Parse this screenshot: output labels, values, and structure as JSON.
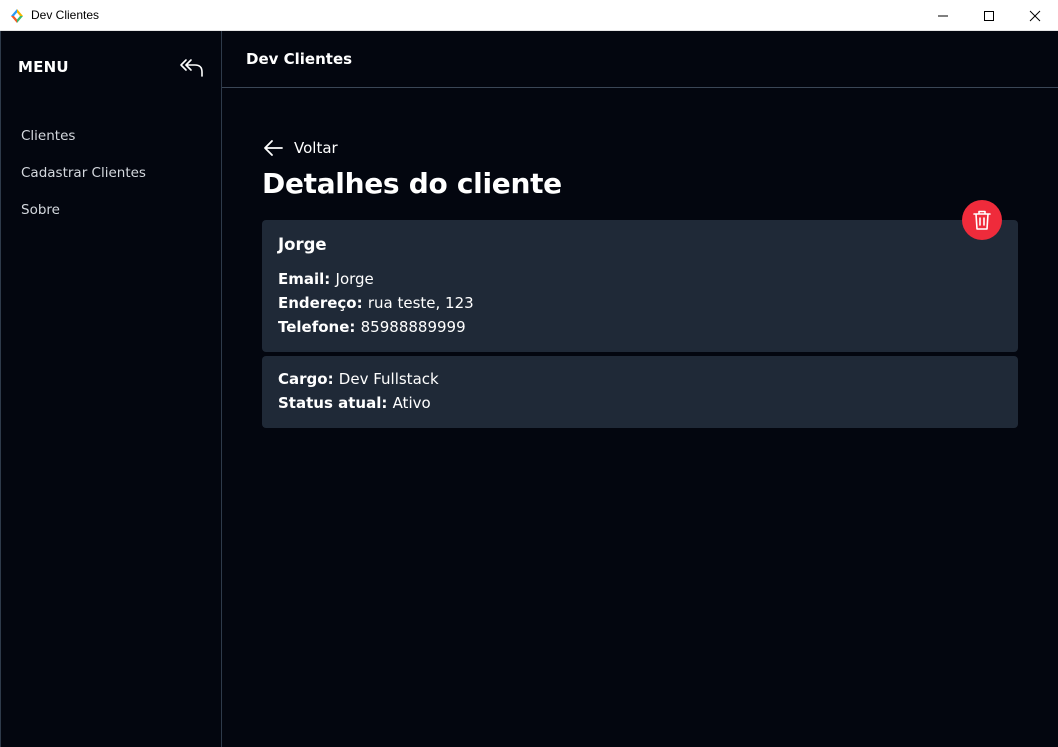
{
  "window": {
    "title": "Dev Clientes",
    "icon": "app-logo-icon",
    "controls": [
      "minimize-icon",
      "maximize-icon",
      "close-icon"
    ]
  },
  "sidebar": {
    "menu_title": "MENU",
    "collapse_icon": "double-arrow-back-icon",
    "items": [
      {
        "label": "Clientes"
      },
      {
        "label": "Cadastrar Clientes"
      },
      {
        "label": "Sobre"
      }
    ]
  },
  "header": {
    "title": "Dev Clientes"
  },
  "main": {
    "back_label": "Voltar",
    "back_icon": "arrow-left-icon",
    "page_title": "Detalhes do cliente",
    "delete_icon": "trash-icon",
    "client": {
      "name": "Jorge",
      "email_label": "Email:",
      "email": "Jorge",
      "address_label": "Endereço:",
      "address": "rua teste, 123",
      "phone_label": "Telefone:",
      "phone": "85988889999",
      "role_label": "Cargo:",
      "role": "Dev Fullstack",
      "status_label": "Status atual:",
      "status": "Ativo"
    }
  },
  "colors": {
    "background": "#03060f",
    "card": "#1f2937",
    "delete_button": "#ef2b3b",
    "divider": "#3a4656"
  }
}
